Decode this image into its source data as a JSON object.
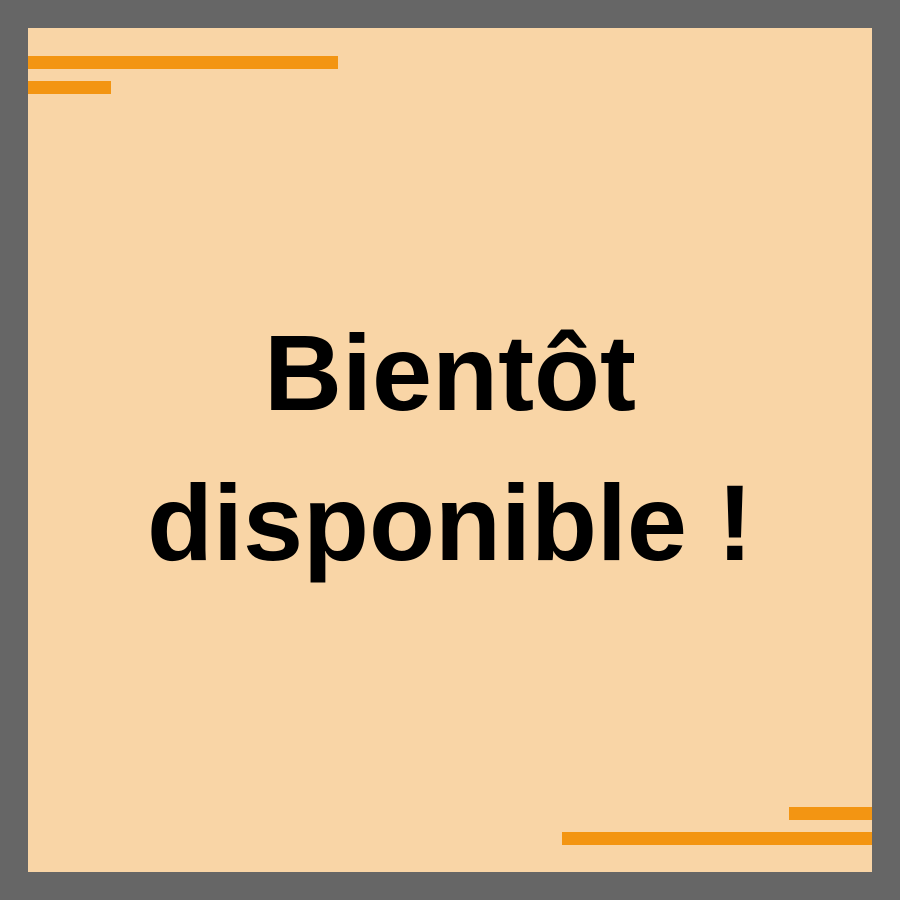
{
  "message": {
    "line1": "Bientôt",
    "line2": "disponible !"
  },
  "colors": {
    "frame": "#666666",
    "background": "#f9d5a6",
    "accent": "#f39512",
    "text": "#000000"
  }
}
